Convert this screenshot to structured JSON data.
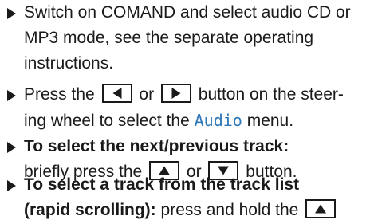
{
  "steps": [
    {
      "lines": [
        "Switch on COMAND and select audio CD or",
        "MP3 mode, see the separate operating",
        "instructions."
      ]
    },
    {
      "line1_pre": "Press the",
      "line1_mid": "or",
      "line1_post": "button on the steer-",
      "line2_pre": "ing wheel to select the",
      "menu_name": "Audio",
      "line2_post": "menu.",
      "keys": [
        "left-arrow-key",
        "right-arrow-key"
      ]
    },
    {
      "bold": "To select the next/previous track:",
      "line2_pre": "briefly press the",
      "line2_mid": "or",
      "line2_post": "button.",
      "keys": [
        "up-arrow-key",
        "down-arrow-key"
      ]
    },
    {
      "bold_line1": "To select a track from the track list",
      "bold_line2": "(rapid scrolling):",
      "line2_post": "press and hold the",
      "keys": [
        "up-arrow-key"
      ]
    }
  ],
  "colors": {
    "text": "#1a1a1a",
    "menu_highlight": "#2f78b7"
  }
}
